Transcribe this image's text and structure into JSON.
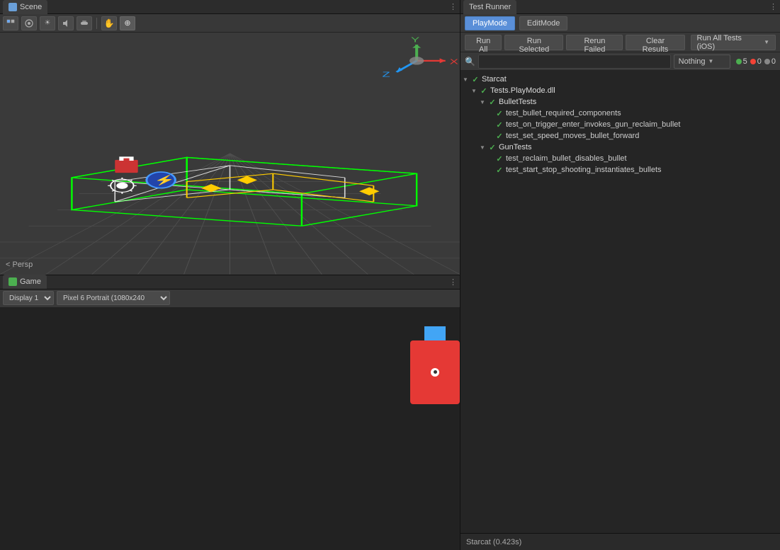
{
  "scene_panel": {
    "tab_label": "Scene",
    "persp_label": "< Persp"
  },
  "game_panel": {
    "tab_label": "Game",
    "display_label": "Display 1",
    "resolution_label": "Pixel 6 Portrait (1080x240"
  },
  "test_runner": {
    "tab_label": "Test Runner",
    "mode_play": "PlayMode",
    "mode_edit": "EditMode",
    "btn_run_all": "Run All",
    "btn_run_selected": "Run Selected",
    "btn_rerun_failed": "Rerun Failed",
    "btn_clear_results": "Clear Results",
    "btn_run_all_ios": "Run All Tests (iOS)",
    "filter_nothing": "Nothing",
    "count_pass": 5,
    "count_fail": 0,
    "count_skip": 0,
    "status_bar_text": "Starcat (0.423s)",
    "tree": [
      {
        "id": "starcat",
        "label": "Starcat",
        "type": "root",
        "status": "pass",
        "indent": 0,
        "children": [
          {
            "id": "tests-playmode",
            "label": "Tests.PlayMode.dll",
            "type": "dll",
            "status": "pass",
            "indent": 1,
            "children": [
              {
                "id": "bullet-tests",
                "label": "BulletTests",
                "type": "class",
                "status": "pass",
                "indent": 2,
                "children": [
                  {
                    "id": "test1",
                    "label": "test_bullet_required_components",
                    "type": "test",
                    "status": "pass",
                    "indent": 3
                  },
                  {
                    "id": "test2",
                    "label": "test_on_trigger_enter_invokes_gun_reclaim_bullet",
                    "type": "test",
                    "status": "pass",
                    "indent": 3
                  },
                  {
                    "id": "test3",
                    "label": "test_set_speed_moves_bullet_forward",
                    "type": "test",
                    "status": "pass",
                    "indent": 3
                  }
                ]
              },
              {
                "id": "gun-tests",
                "label": "GunTests",
                "type": "class",
                "status": "pass",
                "indent": 2,
                "children": [
                  {
                    "id": "test4",
                    "label": "test_reclaim_bullet_disables_bullet",
                    "type": "test",
                    "status": "pass",
                    "indent": 3
                  },
                  {
                    "id": "test5",
                    "label": "test_start_stop_shooting_instantiates_bullets",
                    "type": "test",
                    "status": "pass",
                    "indent": 3
                  }
                ]
              }
            ]
          }
        ]
      }
    ]
  }
}
